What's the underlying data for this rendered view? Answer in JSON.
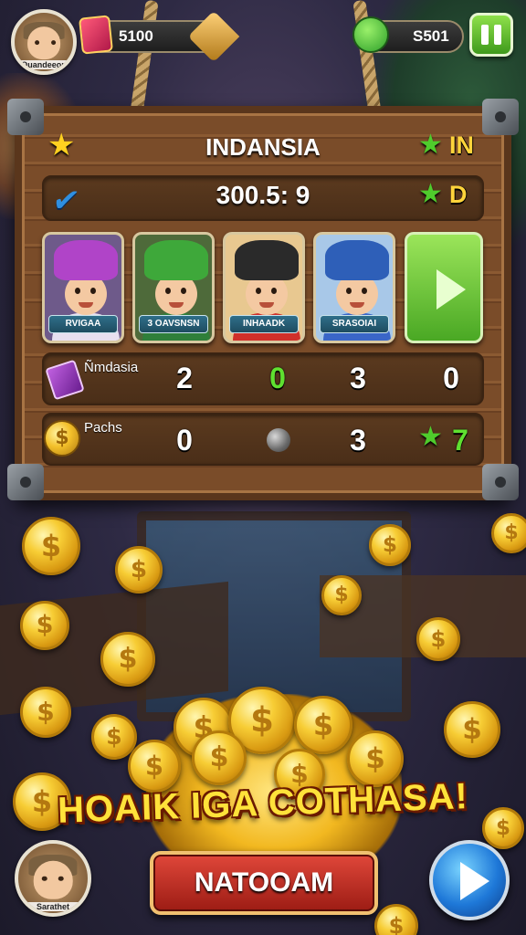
{
  "player": {
    "name": "Quandeeon"
  },
  "resources": {
    "gems": "5100",
    "cash": "S501"
  },
  "board": {
    "title": "INDANSIA",
    "title_tag": "IN",
    "score": "300.5: 9",
    "score_tag": "D",
    "characters": [
      {
        "label": "RVIGAA",
        "hat_color": "#b044c8",
        "body_color": "#e8e0f0",
        "bg": "#6e5a8a"
      },
      {
        "label": "3 OAVSNSN",
        "hat_color": "#3ea83a",
        "body_color": "#2f7f3a",
        "bg": "#4e6a3a"
      },
      {
        "label": "INHAADK",
        "hat_color": "#2a2a2a",
        "body_color": "#d0302a",
        "bg": "#e8c890"
      },
      {
        "label": "SRASOIAI",
        "hat_color": "#2e5fb8",
        "body_color": "#3a66c8",
        "bg": "#a8c8e8"
      }
    ],
    "stats": [
      {
        "label": "Ñmdasia",
        "values": [
          "2",
          "0",
          "3",
          "0"
        ]
      },
      {
        "label": "Pachs",
        "values": [
          "0",
          "",
          "3",
          "7"
        ]
      }
    ]
  },
  "banner": {
    "text": "HOAIK IGA COTHASA!"
  },
  "buttons": {
    "main": "NATOOAM"
  },
  "bottom_player": {
    "name": "Sarathet"
  }
}
